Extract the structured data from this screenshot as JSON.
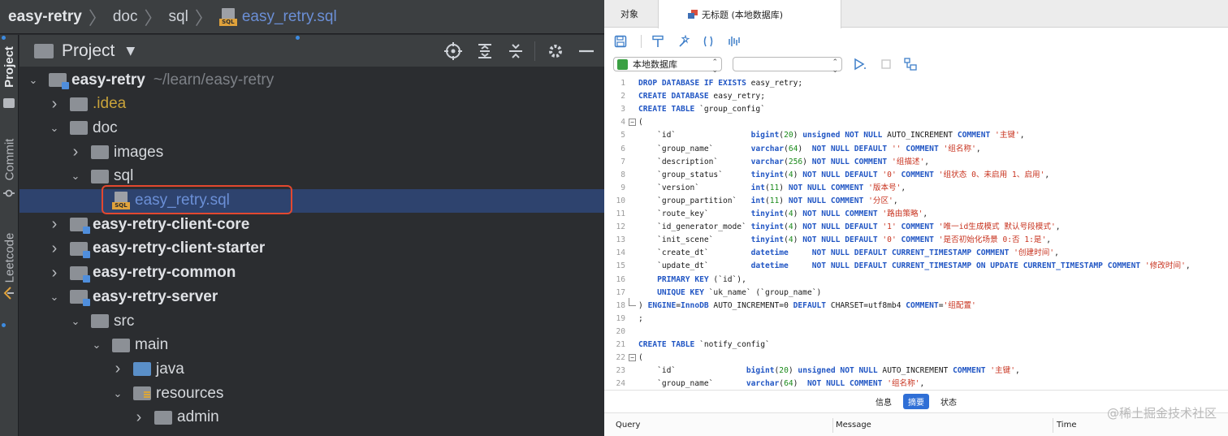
{
  "ide": {
    "breadcrumb": [
      "easy-retry",
      "doc",
      "sql",
      "easy_retry.sql"
    ],
    "side_tabs": [
      "Project",
      "Commit",
      "Leetcode"
    ],
    "panel_title": "Project",
    "tree": [
      {
        "name": "easy-retry",
        "path": "~/learn/easy-retry",
        "depth": 0,
        "expanded": true,
        "icon": "module-folder-icon",
        "bold": true
      },
      {
        "name": ".idea",
        "depth": 1,
        "expanded": false,
        "icon": "folder-icon"
      },
      {
        "name": "doc",
        "depth": 1,
        "expanded": true,
        "icon": "folder-icon"
      },
      {
        "name": "images",
        "depth": 2,
        "expanded": false,
        "icon": "folder-icon"
      },
      {
        "name": "sql",
        "depth": 2,
        "expanded": true,
        "icon": "folder-icon"
      },
      {
        "name": "easy_retry.sql",
        "depth": 3,
        "icon": "sql-file-icon",
        "selected": true
      },
      {
        "name": "easy-retry-client-core",
        "depth": 1,
        "expanded": false,
        "icon": "module-folder-icon",
        "bold": true
      },
      {
        "name": "easy-retry-client-starter",
        "depth": 1,
        "expanded": false,
        "icon": "module-folder-icon",
        "bold": true
      },
      {
        "name": "easy-retry-common",
        "depth": 1,
        "expanded": false,
        "icon": "module-folder-icon",
        "bold": true
      },
      {
        "name": "easy-retry-server",
        "depth": 1,
        "expanded": true,
        "icon": "module-folder-icon",
        "bold": true
      },
      {
        "name": "src",
        "depth": 2,
        "expanded": true,
        "icon": "folder-icon"
      },
      {
        "name": "main",
        "depth": 3,
        "expanded": true,
        "icon": "folder-icon"
      },
      {
        "name": "java",
        "depth": 4,
        "expanded": false,
        "icon": "source-folder-icon"
      },
      {
        "name": "resources",
        "depth": 4,
        "expanded": true,
        "icon": "resources-folder-icon"
      },
      {
        "name": "admin",
        "depth": 5,
        "expanded": false,
        "icon": "folder-icon"
      }
    ]
  },
  "navicat": {
    "tabs": [
      "对象",
      "无标题 (本地数据库)"
    ],
    "connection": "本地数据库",
    "database": "",
    "lines": [
      "DROP DATABASE IF EXISTS easy_retry;",
      "CREATE DATABASE easy_retry;",
      "CREATE TABLE `group_config`",
      "(",
      "    `id`                bigint(20) unsigned NOT NULL AUTO_INCREMENT COMMENT '主键',",
      "    `group_name`        varchar(64)  NOT NULL DEFAULT '' COMMENT '组名称',",
      "    `description`       varchar(256) NOT NULL COMMENT '组描述',",
      "    `group_status`      tinyint(4) NOT NULL DEFAULT '0' COMMENT '组状态 0、未启用 1、启用',",
      "    `version`           int(11) NOT NULL COMMENT '版本号',",
      "    `group_partition`   int(11) NOT NULL COMMENT '分区',",
      "    `route_key`         tinyint(4) NOT NULL COMMENT '路由策略',",
      "    `id_generator_mode` tinyint(4) NOT NULL DEFAULT '1' COMMENT '唯一id生成模式 默认号段模式',",
      "    `init_scene`        tinyint(4) NOT NULL DEFAULT '0' COMMENT '是否初始化场景 0:否 1:是',",
      "    `create_dt`         datetime     NOT NULL DEFAULT CURRENT_TIMESTAMP COMMENT '创建时间',",
      "    `update_dt`         datetime     NOT NULL DEFAULT CURRENT_TIMESTAMP ON UPDATE CURRENT_TIMESTAMP COMMENT '修改时间',",
      "    PRIMARY KEY (`id`),",
      "    UNIQUE KEY `uk_name` (`group_name`)",
      ") ENGINE=InnoDB AUTO_INCREMENT=0 DEFAULT CHARSET=utf8mb4 COMMENT='组配置'",
      ";",
      "",
      "CREATE TABLE `notify_config`",
      "(",
      "    `id`               bigint(20) unsigned NOT NULL AUTO_INCREMENT COMMENT '主键',",
      "    `group_name`       varchar(64)  NOT NULL COMMENT '组名称',"
    ],
    "fold_lines": [
      4,
      18,
      22
    ],
    "bottom_tabs": [
      "信息",
      "摘要",
      "状态"
    ],
    "active_bottom_tab": "摘要",
    "result_columns": [
      "Query",
      "Message",
      "Time"
    ]
  },
  "watermark": "@稀土掘金技术社区"
}
